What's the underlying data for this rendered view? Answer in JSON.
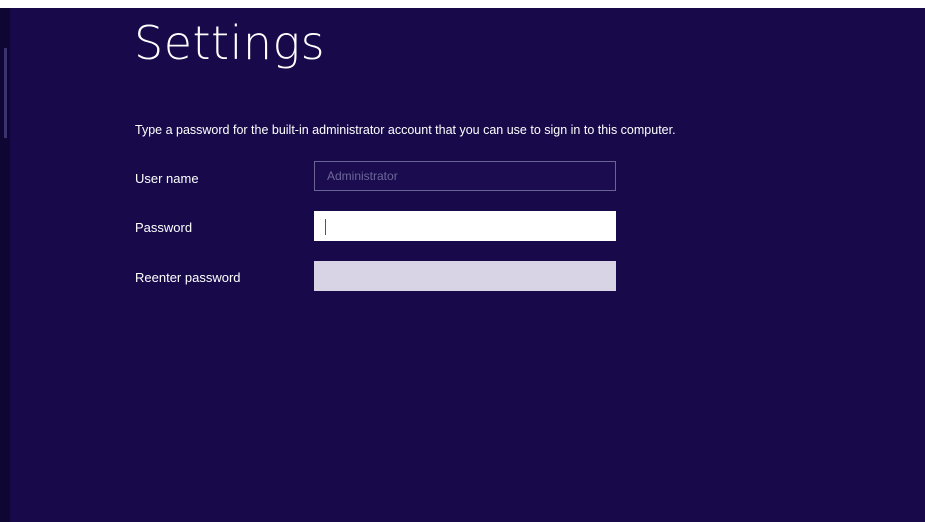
{
  "page": {
    "title": "Settings",
    "instructions": "Type a password for the built-in administrator account that you can use to sign in to this computer."
  },
  "form": {
    "username": {
      "label": "User name",
      "value": "Administrator"
    },
    "password": {
      "label": "Password",
      "value": ""
    },
    "reenter_password": {
      "label": "Reenter password",
      "value": ""
    }
  },
  "colors": {
    "background": "#180a4a",
    "text": "#ffffff",
    "disabled_field_border": "#6a6494",
    "inactive_field_fill": "#d8d4e6"
  }
}
